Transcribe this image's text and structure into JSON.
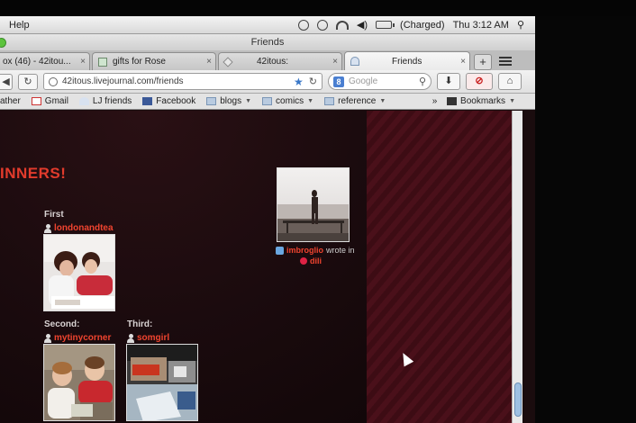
{
  "menubar": {
    "help": "Help",
    "battery": "(Charged)",
    "clock": "Thu 3:12 AM"
  },
  "window": {
    "title": "Friends"
  },
  "tabs": [
    {
      "label": "ox (46) - 42itou...",
      "active": false
    },
    {
      "label": "gifts for Rose",
      "active": false
    },
    {
      "label": "42itous:",
      "active": false
    },
    {
      "label": "Friends",
      "active": true
    }
  ],
  "tab_plus": "+",
  "navbar": {
    "url": "42itous.livejournal.com/friends",
    "search_placeholder": "Google",
    "search_engine_letter": "8"
  },
  "bookmarks": {
    "items": [
      {
        "label": "ather",
        "icon": "none"
      },
      {
        "label": "Gmail",
        "icon": "gmail"
      },
      {
        "label": "LJ friends",
        "icon": "lj"
      },
      {
        "label": "Facebook",
        "icon": "facebook"
      },
      {
        "label": "blogs",
        "icon": "folder",
        "dropdown": true
      },
      {
        "label": "comics",
        "icon": "folder",
        "dropdown": true
      },
      {
        "label": "reference",
        "icon": "folder",
        "dropdown": true
      }
    ],
    "overflow": "»",
    "bookmarks_menu": "Bookmarks"
  },
  "page": {
    "heading": "INNERS!",
    "winners": {
      "first_label": "First",
      "first_user": "londonandtea",
      "second_label": "Second:",
      "second_user": "mytinycorner",
      "third_label": "Third:",
      "third_user": "somgirl"
    },
    "post": {
      "author": "imbroglio",
      "wrote_in": "wrote in",
      "community": "dili"
    }
  },
  "colors": {
    "accent_red": "#f0442f",
    "heading_red": "#e23b2c",
    "page_bg": "#1c0d10",
    "stripe_bg": "#4a101a"
  }
}
